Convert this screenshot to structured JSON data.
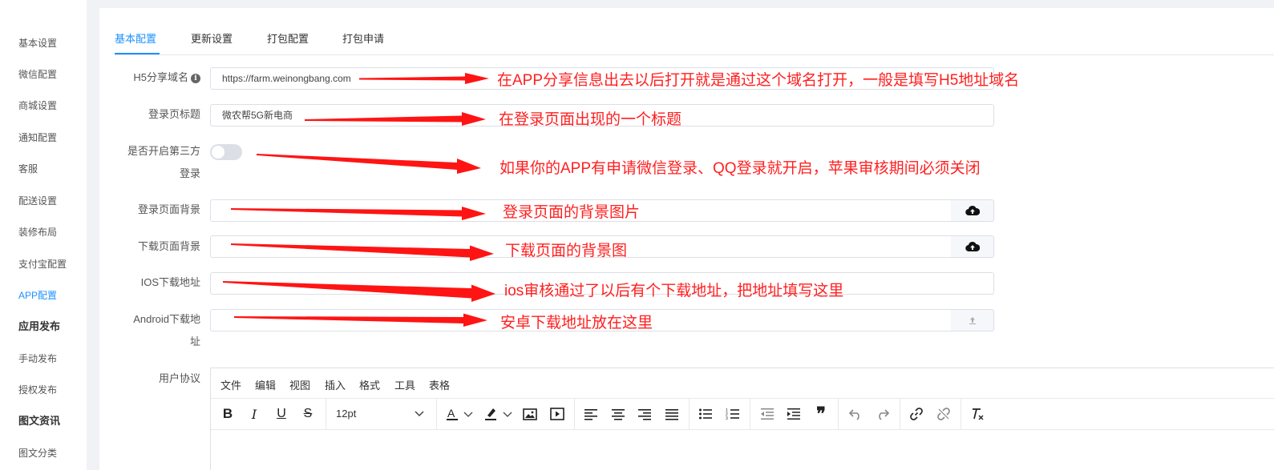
{
  "sidebar": {
    "items": [
      {
        "label": "基本设置"
      },
      {
        "label": "微信配置"
      },
      {
        "label": "商城设置"
      },
      {
        "label": "通知配置"
      },
      {
        "label": "客服"
      },
      {
        "label": "配送设置"
      },
      {
        "label": "装修布局"
      },
      {
        "label": "支付宝配置"
      },
      {
        "label": "APP配置"
      },
      {
        "label": "应用发布"
      },
      {
        "label": "手动发布"
      },
      {
        "label": "授权发布"
      },
      {
        "label": "图文资讯"
      },
      {
        "label": "图文分类"
      }
    ],
    "active_item": "APP配置"
  },
  "tabs": [
    {
      "label": "基本配置"
    },
    {
      "label": "更新设置"
    },
    {
      "label": "打包配置"
    },
    {
      "label": "打包申请"
    }
  ],
  "form": {
    "h5_domain": {
      "label": "H5分享域名",
      "value": "https://farm.weinongbang.com"
    },
    "login_title": {
      "label": "登录页标题",
      "value": "微农帮5G新电商"
    },
    "third_party_login": {
      "label_line1": "是否开启第三方",
      "label_line2": "登录",
      "enabled": false
    },
    "login_background": {
      "label": "登录页面背景",
      "value": ""
    },
    "download_background": {
      "label": "下载页面背景",
      "value": ""
    },
    "ios_download": {
      "label": "IOS下载地址",
      "value": ""
    },
    "android_download": {
      "label_line1": "Android下载地",
      "label_line2": "址",
      "value": ""
    },
    "user_agreement": {
      "label": "用户协议"
    }
  },
  "editor": {
    "menu": [
      "文件",
      "编辑",
      "视图",
      "插入",
      "格式",
      "工具",
      "表格"
    ],
    "font_size": "12pt",
    "icons": [
      "bold-icon",
      "italic-icon",
      "underline-icon",
      "strikethrough-icon",
      "text-color-icon",
      "highlight-icon",
      "image-icon",
      "media-icon",
      "align-left-icon",
      "align-center-icon",
      "align-right-icon",
      "align-justify-icon",
      "bullet-list-icon",
      "numbered-list-icon",
      "outdent-icon",
      "indent-icon",
      "blockquote-icon",
      "undo-icon",
      "redo-icon",
      "link-icon",
      "unlink-icon",
      "clear-format-icon"
    ]
  },
  "annotations": {
    "h5_domain": "在APP分享信息出去以后打开就是通过这个域名打开，一般是填写H5地址域名",
    "login_title": "在登录页面出现的一个标题",
    "third_party_login": "如果你的APP有申请微信登录、QQ登录就开启，苹果审核期间必须关闭",
    "login_background": "登录页面的背景图片",
    "download_background": "下载页面的背景图",
    "ios_download": "ios审核通过了以后有个下载地址，把地址填写这里",
    "android_download": "安卓下载地址放在这里"
  },
  "colors": {
    "accent": "#1e90ff",
    "annotation": "#ff1f1f"
  }
}
